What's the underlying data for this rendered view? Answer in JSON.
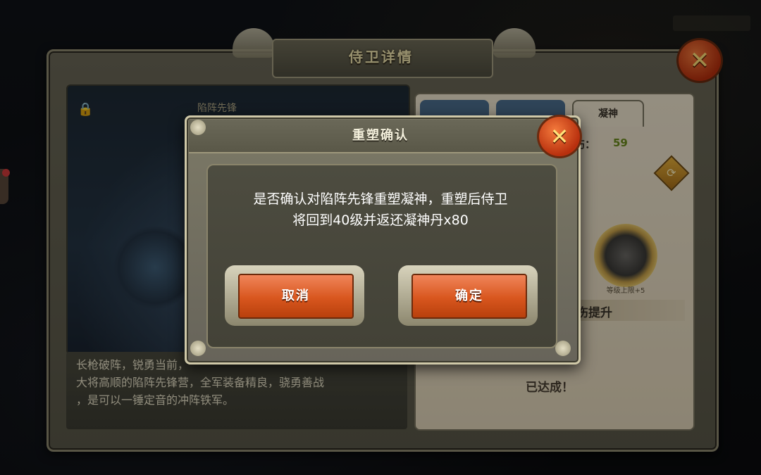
{
  "hud": {
    "corner_text": ""
  },
  "main_panel": {
    "title": "侍卫详情",
    "close_glyph": "✕"
  },
  "hero": {
    "name": "陷阵先锋",
    "description_line1": "长枪破阵，锐勇当前，",
    "description_line2": "大将高顺的陷阵先锋营，全军装备精良，骁勇善战",
    "description_line3": "，是可以一锤定音的冲阵铁军。"
  },
  "stats_panel": {
    "tabs": [
      "",
      "",
      "凝神"
    ],
    "active_tab": "凝神",
    "damage_label": "伤：",
    "damage_value": "59",
    "medal_caption": "等级上限+5",
    "boost_label": "伤提升",
    "achieved_text": "已达成！"
  },
  "dialog": {
    "title": "重塑确认",
    "message_line1": "是否确认对陷阵先锋重塑凝神，重塑后侍卫",
    "message_line2": "将回到40级并返还凝神丹x80",
    "cancel_label": "取消",
    "confirm_label": "确定",
    "close_glyph": "✕"
  },
  "colors": {
    "button_orange": "#d8561e",
    "panel_olive": "#67645a",
    "accent_gold": "#e7c76a"
  },
  "icons": [
    "lock-icon",
    "close-icon",
    "refresh-icon",
    "medal-icon"
  ]
}
